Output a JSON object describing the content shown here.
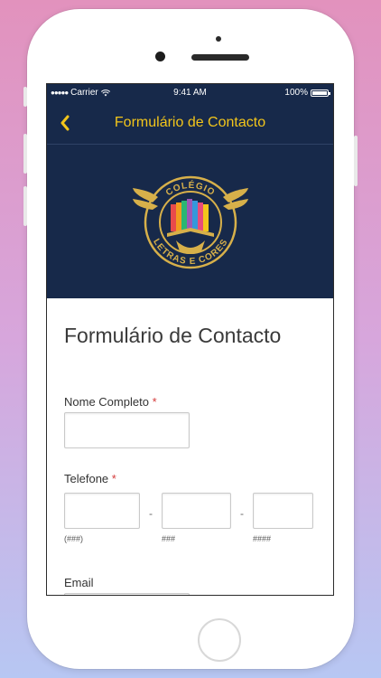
{
  "status_bar": {
    "carrier": "Carrier",
    "time": "9:41 AM",
    "battery": "100%"
  },
  "nav": {
    "title": "Formulário de Contacto",
    "back_icon": "chevron-left-icon"
  },
  "logo": {
    "top_text": "COLÉGIO",
    "bottom_text": "LETRAS E CORES"
  },
  "form": {
    "title": "Formulário de Contacto",
    "full_name": {
      "label": "Nome Completo",
      "required_mark": "*"
    },
    "phone": {
      "label": "Telefone",
      "required_mark": "*",
      "separator": "-",
      "area_hint": "(###)",
      "prefix_hint": "###",
      "line_hint": "####"
    },
    "email": {
      "label": "Email"
    }
  },
  "colors": {
    "nav_background": "#17294a",
    "accent_yellow": "#f2c51b",
    "required_red": "#d53b3b"
  }
}
